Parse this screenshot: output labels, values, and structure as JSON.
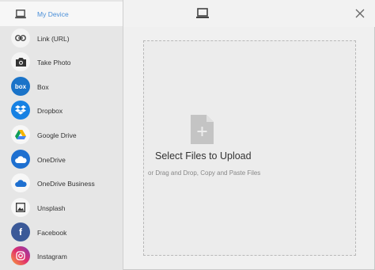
{
  "sidebar": {
    "items": [
      {
        "label": "My Device",
        "icon": "laptop-icon",
        "active": true
      },
      {
        "label": "Link (URL)",
        "icon": "link-icon"
      },
      {
        "label": "Take Photo",
        "icon": "camera-icon"
      },
      {
        "label": "Box",
        "icon": "box-logo-icon",
        "badge": "box"
      },
      {
        "label": "Dropbox",
        "icon": "dropbox-logo-icon"
      },
      {
        "label": "Google Drive",
        "icon": "google-drive-logo-icon"
      },
      {
        "label": "OneDrive",
        "icon": "onedrive-logo-icon"
      },
      {
        "label": "OneDrive Business",
        "icon": "onedrive-business-logo-icon"
      },
      {
        "label": "Unsplash",
        "icon": "image-icon"
      },
      {
        "label": "Facebook",
        "icon": "facebook-logo-icon",
        "badge": "f"
      },
      {
        "label": "Instagram",
        "icon": "instagram-logo-icon"
      }
    ]
  },
  "header": {
    "device_icon": "laptop-icon",
    "close_icon": "close-icon"
  },
  "dropzone": {
    "title": "Select Files to Upload",
    "subtitle": "or Drag and Drop, Copy and Paste Files",
    "icon": "add-file-icon"
  },
  "colors": {
    "accent": "#4a8fd8",
    "box": "#1a73c8",
    "dropbox": "#1681e3",
    "onedrive": "#1d6fd0",
    "facebook": "#3b5998"
  }
}
